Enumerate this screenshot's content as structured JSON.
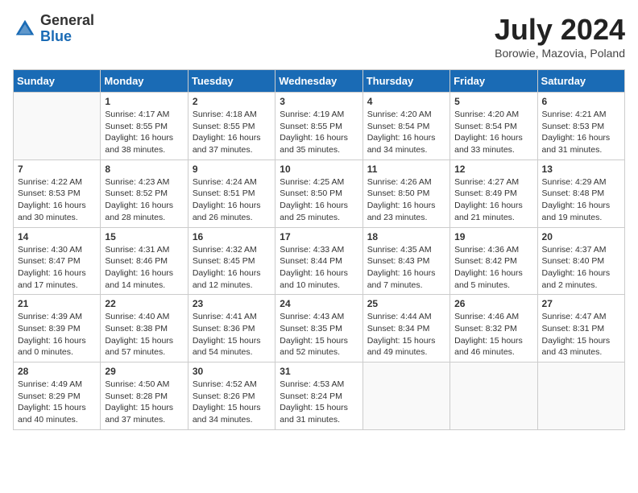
{
  "header": {
    "logo_general": "General",
    "logo_blue": "Blue",
    "month_year": "July 2024",
    "location": "Borowie, Mazovia, Poland"
  },
  "weekdays": [
    "Sunday",
    "Monday",
    "Tuesday",
    "Wednesday",
    "Thursday",
    "Friday",
    "Saturday"
  ],
  "weeks": [
    [
      {
        "day": null
      },
      {
        "day": 1,
        "sunrise": "4:17 AM",
        "sunset": "8:55 PM",
        "daylight_hours": "16 hours and 38 minutes."
      },
      {
        "day": 2,
        "sunrise": "4:18 AM",
        "sunset": "8:55 PM",
        "daylight_hours": "16 hours and 37 minutes."
      },
      {
        "day": 3,
        "sunrise": "4:19 AM",
        "sunset": "8:55 PM",
        "daylight_hours": "16 hours and 35 minutes."
      },
      {
        "day": 4,
        "sunrise": "4:20 AM",
        "sunset": "8:54 PM",
        "daylight_hours": "16 hours and 34 minutes."
      },
      {
        "day": 5,
        "sunrise": "4:20 AM",
        "sunset": "8:54 PM",
        "daylight_hours": "16 hours and 33 minutes."
      },
      {
        "day": 6,
        "sunrise": "4:21 AM",
        "sunset": "8:53 PM",
        "daylight_hours": "16 hours and 31 minutes."
      }
    ],
    [
      {
        "day": 7,
        "sunrise": "4:22 AM",
        "sunset": "8:53 PM",
        "daylight_hours": "16 hours and 30 minutes."
      },
      {
        "day": 8,
        "sunrise": "4:23 AM",
        "sunset": "8:52 PM",
        "daylight_hours": "16 hours and 28 minutes."
      },
      {
        "day": 9,
        "sunrise": "4:24 AM",
        "sunset": "8:51 PM",
        "daylight_hours": "16 hours and 26 minutes."
      },
      {
        "day": 10,
        "sunrise": "4:25 AM",
        "sunset": "8:50 PM",
        "daylight_hours": "16 hours and 25 minutes."
      },
      {
        "day": 11,
        "sunrise": "4:26 AM",
        "sunset": "8:50 PM",
        "daylight_hours": "16 hours and 23 minutes."
      },
      {
        "day": 12,
        "sunrise": "4:27 AM",
        "sunset": "8:49 PM",
        "daylight_hours": "16 hours and 21 minutes."
      },
      {
        "day": 13,
        "sunrise": "4:29 AM",
        "sunset": "8:48 PM",
        "daylight_hours": "16 hours and 19 minutes."
      }
    ],
    [
      {
        "day": 14,
        "sunrise": "4:30 AM",
        "sunset": "8:47 PM",
        "daylight_hours": "16 hours and 17 minutes."
      },
      {
        "day": 15,
        "sunrise": "4:31 AM",
        "sunset": "8:46 PM",
        "daylight_hours": "16 hours and 14 minutes."
      },
      {
        "day": 16,
        "sunrise": "4:32 AM",
        "sunset": "8:45 PM",
        "daylight_hours": "16 hours and 12 minutes."
      },
      {
        "day": 17,
        "sunrise": "4:33 AM",
        "sunset": "8:44 PM",
        "daylight_hours": "16 hours and 10 minutes."
      },
      {
        "day": 18,
        "sunrise": "4:35 AM",
        "sunset": "8:43 PM",
        "daylight_hours": "16 hours and 7 minutes."
      },
      {
        "day": 19,
        "sunrise": "4:36 AM",
        "sunset": "8:42 PM",
        "daylight_hours": "16 hours and 5 minutes."
      },
      {
        "day": 20,
        "sunrise": "4:37 AM",
        "sunset": "8:40 PM",
        "daylight_hours": "16 hours and 2 minutes."
      }
    ],
    [
      {
        "day": 21,
        "sunrise": "4:39 AM",
        "sunset": "8:39 PM",
        "daylight_hours": "16 hours and 0 minutes."
      },
      {
        "day": 22,
        "sunrise": "4:40 AM",
        "sunset": "8:38 PM",
        "daylight_hours": "15 hours and 57 minutes."
      },
      {
        "day": 23,
        "sunrise": "4:41 AM",
        "sunset": "8:36 PM",
        "daylight_hours": "15 hours and 54 minutes."
      },
      {
        "day": 24,
        "sunrise": "4:43 AM",
        "sunset": "8:35 PM",
        "daylight_hours": "15 hours and 52 minutes."
      },
      {
        "day": 25,
        "sunrise": "4:44 AM",
        "sunset": "8:34 PM",
        "daylight_hours": "15 hours and 49 minutes."
      },
      {
        "day": 26,
        "sunrise": "4:46 AM",
        "sunset": "8:32 PM",
        "daylight_hours": "15 hours and 46 minutes."
      },
      {
        "day": 27,
        "sunrise": "4:47 AM",
        "sunset": "8:31 PM",
        "daylight_hours": "15 hours and 43 minutes."
      }
    ],
    [
      {
        "day": 28,
        "sunrise": "4:49 AM",
        "sunset": "8:29 PM",
        "daylight_hours": "15 hours and 40 minutes."
      },
      {
        "day": 29,
        "sunrise": "4:50 AM",
        "sunset": "8:28 PM",
        "daylight_hours": "15 hours and 37 minutes."
      },
      {
        "day": 30,
        "sunrise": "4:52 AM",
        "sunset": "8:26 PM",
        "daylight_hours": "15 hours and 34 minutes."
      },
      {
        "day": 31,
        "sunrise": "4:53 AM",
        "sunset": "8:24 PM",
        "daylight_hours": "15 hours and 31 minutes."
      },
      {
        "day": null
      },
      {
        "day": null
      },
      {
        "day": null
      }
    ]
  ],
  "labels": {
    "sunrise": "Sunrise:",
    "sunset": "Sunset:",
    "daylight": "Daylight:"
  }
}
